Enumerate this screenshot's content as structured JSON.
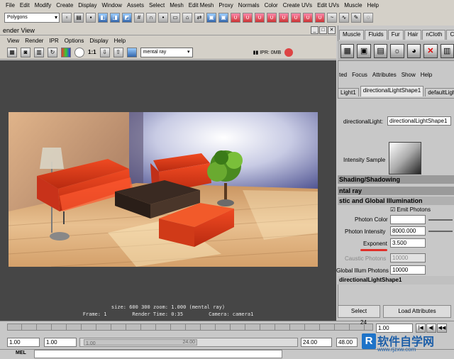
{
  "maya_menu": [
    "File",
    "Edit",
    "Modify",
    "Create",
    "Display",
    "Window",
    "Assets",
    "Select",
    "Mesh",
    "Edit Mesh",
    "Proxy",
    "Normals",
    "Color",
    "Create UVs",
    "Edit UVs",
    "Muscle",
    "Help"
  ],
  "mode_select": "Polygons",
  "shelf_tabs": [
    "Muscle",
    "Fluids",
    "Fur",
    "Hair",
    "nCloth",
    "Co"
  ],
  "render_view": {
    "title": "ender View",
    "menu": [
      "View",
      "Render",
      "IPR",
      "Options",
      "Display",
      "Help"
    ],
    "ratio_label": "1:1",
    "renderer": "mental ray",
    "ipr_status": "IPR: 0MB",
    "info_line1": "size:  600  300 zoom: 1.000        (mental ray)",
    "info_frame": "Frame: 1",
    "info_render_time": "Render Time: 0:35",
    "info_camera": "Camera: camera1"
  },
  "attribute_editor": {
    "menu": [
      "ted",
      "Focus",
      "Attributes",
      "Show",
      "Help"
    ],
    "tabs": [
      "Light1",
      "directionalLightShape1",
      "defaultLightS"
    ],
    "light_label": "directionalLight:",
    "light_name": "directionalLightShape1",
    "intensity_sample_label": "Intensity Sample",
    "section_shading": "Shading/Shadowing",
    "section_mental_ray": "ntal ray",
    "section_caustic": "stic and Global Illumination",
    "emit_photons_label": "Emit Photons",
    "photon_color_label": "Photon Color",
    "photon_intensity_label": "Photon Intensity",
    "photon_intensity_value": "8000.000",
    "exponent_label": "Exponent",
    "exponent_value": "3.500",
    "caustic_photons_label": "Caustic Photons",
    "caustic_photons_value": "10000",
    "global_illum_label": "Global Illum Photons",
    "global_illum_value": "10000",
    "footer_node": "directionalLightShape1",
    "select_button": "Select",
    "load_attributes_button": "Load Attributes"
  },
  "timeline": {
    "frame_marker": "24",
    "current_frame": "1.00",
    "range_start": "1.00",
    "range_start2": "1.00",
    "range_slider_start": "1.00",
    "range_slider_end": "24.00",
    "range_end": "24.00",
    "range_end2": "48.00",
    "mel_label": "MEL"
  },
  "watermark": {
    "logo": "R",
    "title": "软件自学网",
    "url": "www.rjzxw.com"
  },
  "colors": {
    "accent_red": "#e0302a",
    "sofa_red": "#e0401e",
    "watermark_blue": "#1e73c8"
  }
}
